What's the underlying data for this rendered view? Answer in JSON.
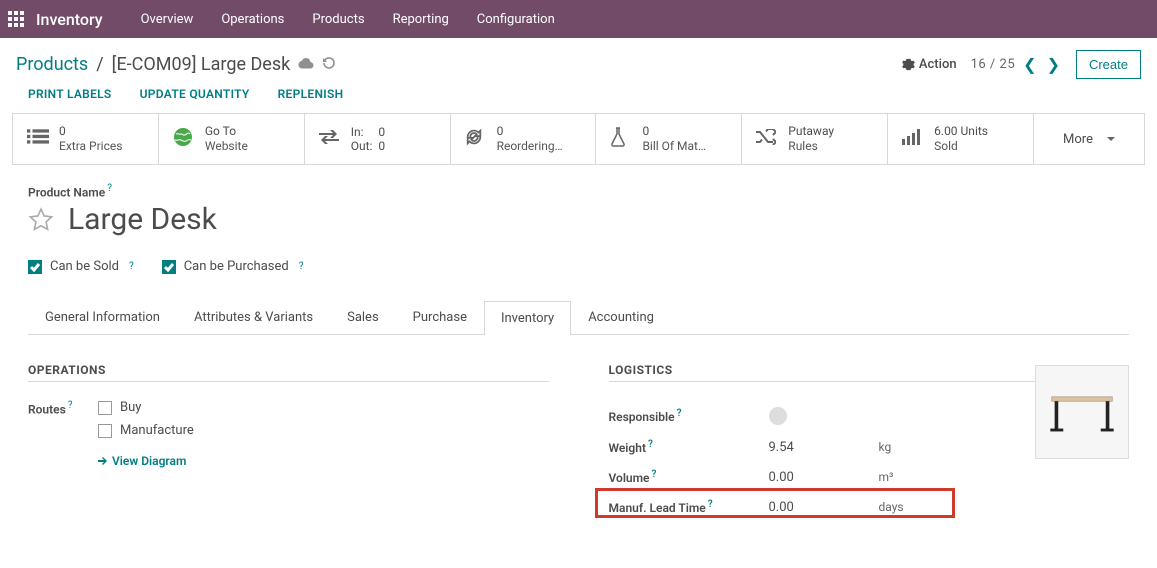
{
  "nav": {
    "brand": "Inventory",
    "items": [
      "Overview",
      "Operations",
      "Products",
      "Reporting",
      "Configuration"
    ]
  },
  "breadcrumb": {
    "parent": "Products",
    "current": "[E-COM09] Large Desk"
  },
  "controls": {
    "action": "Action",
    "pager_pos": "16",
    "pager_total": "25",
    "create": "Create"
  },
  "actionbar": {
    "print_labels": "PRINT LABELS",
    "update_qty": "UPDATE QUANTITY",
    "replenish": "REPLENISH"
  },
  "statboxes": {
    "extra_prices": {
      "count": "0",
      "label": "Extra Prices"
    },
    "website": {
      "line1": "Go To",
      "line2": "Website"
    },
    "inout": {
      "in_lbl": "In:",
      "in_val": "0",
      "out_lbl": "Out:",
      "out_val": "0"
    },
    "reordering": {
      "count": "0",
      "label": "Reordering…"
    },
    "bom": {
      "count": "0",
      "label": "Bill Of Mat…"
    },
    "putaway": {
      "line1": "Putaway",
      "line2": "Rules"
    },
    "sold": {
      "count": "6.00 Units",
      "label": "Sold"
    },
    "more": "More"
  },
  "product": {
    "name_label": "Product Name",
    "name": "Large Desk",
    "can_be_sold": "Can be Sold",
    "can_be_purchased": "Can be Purchased"
  },
  "tabs": [
    "General Information",
    "Attributes & Variants",
    "Sales",
    "Purchase",
    "Inventory",
    "Accounting"
  ],
  "sections": {
    "operations": {
      "title": "OPERATIONS",
      "routes_label": "Routes",
      "route_buy": "Buy",
      "route_manufacture": "Manufacture",
      "view_diagram": "View Diagram"
    },
    "logistics": {
      "title": "LOGISTICS",
      "responsible": "Responsible",
      "weight_label": "Weight",
      "weight_val": "9.54",
      "weight_unit": "kg",
      "volume_label": "Volume",
      "volume_val": "0.00",
      "volume_unit": "m³",
      "lead_label": "Manuf. Lead Time",
      "lead_val": "0.00",
      "lead_unit": "days"
    }
  }
}
